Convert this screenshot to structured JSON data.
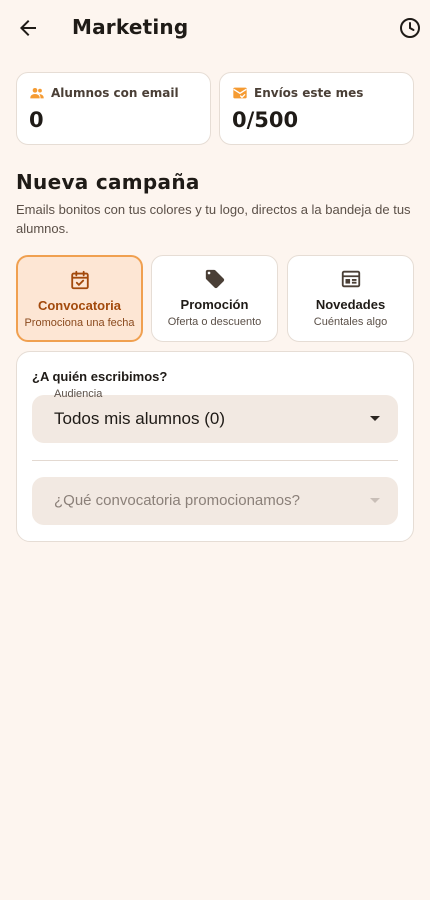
{
  "header": {
    "title": "Marketing",
    "back_icon": "arrow-back-icon",
    "history_icon": "history-clock-icon"
  },
  "stats": [
    {
      "label": "Alumnos con email",
      "value": "0",
      "icon": "people-icon"
    },
    {
      "label": "Envíos este mes",
      "value": "0/500",
      "icon": "mark-email-icon"
    }
  ],
  "new_campaign": {
    "title": "Nueva campaña",
    "subtitle": "Emails bonitos con tus colores y tu logo, directos a la bandeja de tus alumnos."
  },
  "campaign_types": [
    {
      "title": "Convocatoria",
      "subtitle": "Promociona una fecha",
      "icon": "event-available-icon",
      "selected": true
    },
    {
      "title": "Promoción",
      "subtitle": "Oferta o descuento",
      "icon": "tag-icon",
      "selected": false
    },
    {
      "title": "Novedades",
      "subtitle": "Cuéntales algo",
      "icon": "newspaper-icon",
      "selected": false
    }
  ],
  "form": {
    "question": "¿A quién escribimos?",
    "audience": {
      "label": "Audiencia",
      "value": "Todos mis alumnos (0)"
    },
    "campaign_select": {
      "placeholder": "¿Qué convocatoria promocionamos?"
    }
  },
  "colors": {
    "background": "#fdf5ef",
    "accent": "#f0a050",
    "accent_dark": "#a34a0c",
    "icon_orange": "#f59b32"
  }
}
